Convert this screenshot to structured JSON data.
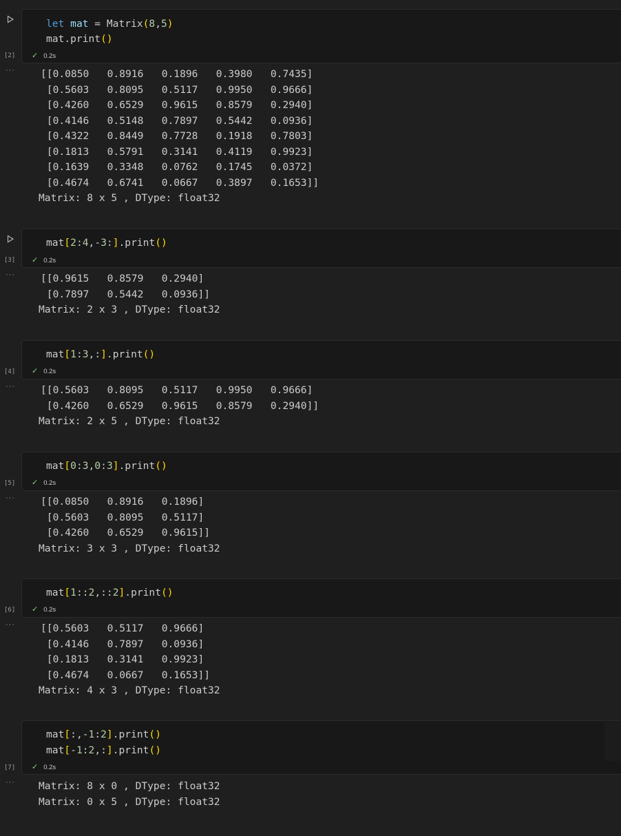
{
  "cells": [
    {
      "exec_count": "[2]",
      "status": "0.2s",
      "code_lines": [
        [
          [
            "kw",
            "let"
          ],
          [
            "txt",
            " "
          ],
          [
            "var",
            "mat"
          ],
          [
            "txt",
            " = Matrix"
          ],
          [
            "br",
            "("
          ],
          [
            "num",
            "8"
          ],
          [
            "txt",
            ","
          ],
          [
            "num",
            "5"
          ],
          [
            "br",
            ")"
          ]
        ],
        [
          [
            "txt",
            "mat.print"
          ],
          [
            "br",
            "()"
          ]
        ]
      ],
      "output_lines": [
        "[[0.0850   0.8916   0.1896   0.3980   0.7435]",
        " [0.5603   0.8095   0.5117   0.9950   0.9666]",
        " [0.4260   0.6529   0.9615   0.8579   0.2940]",
        " [0.4146   0.5148   0.7897   0.5442   0.0936]",
        " [0.4322   0.8449   0.7728   0.1918   0.7803]",
        " [0.1813   0.5791   0.3141   0.4119   0.9923]",
        " [0.1639   0.3348   0.0762   0.1745   0.0372]",
        " [0.4674   0.6741   0.0667   0.3897   0.1653]]",
        "Matrix: 8 x 5 , DType: float32"
      ]
    },
    {
      "exec_count": "[3]",
      "status": "0.2s",
      "code_lines": [
        [
          [
            "txt",
            "mat"
          ],
          [
            "br",
            "["
          ],
          [
            "num",
            "2"
          ],
          [
            "txt",
            ":"
          ],
          [
            "num",
            "4"
          ],
          [
            "txt",
            ",-"
          ],
          [
            "num",
            "3"
          ],
          [
            "txt",
            ":"
          ],
          [
            "br",
            "]"
          ],
          [
            "txt",
            ".print"
          ],
          [
            "br",
            "()"
          ]
        ]
      ],
      "output_lines": [
        "[[0.9615   0.8579   0.2940]",
        " [0.7897   0.5442   0.0936]]",
        "Matrix: 2 x 3 , DType: float32"
      ]
    },
    {
      "exec_count": "[4]",
      "status": "0.2s",
      "code_lines": [
        [
          [
            "txt",
            "mat"
          ],
          [
            "br",
            "["
          ],
          [
            "num",
            "1"
          ],
          [
            "txt",
            ":"
          ],
          [
            "num",
            "3"
          ],
          [
            "txt",
            ",:"
          ],
          [
            "br",
            "]"
          ],
          [
            "txt",
            ".print"
          ],
          [
            "br",
            "()"
          ]
        ]
      ],
      "output_lines": [
        "[[0.5603   0.8095   0.5117   0.9950   0.9666]",
        " [0.4260   0.6529   0.9615   0.8579   0.2940]]",
        "Matrix: 2 x 5 , DType: float32"
      ]
    },
    {
      "exec_count": "[5]",
      "status": "0.2s",
      "code_lines": [
        [
          [
            "txt",
            "mat"
          ],
          [
            "br",
            "["
          ],
          [
            "num",
            "0"
          ],
          [
            "txt",
            ":"
          ],
          [
            "num",
            "3"
          ],
          [
            "txt",
            ","
          ],
          [
            "num",
            "0"
          ],
          [
            "txt",
            ":"
          ],
          [
            "num",
            "3"
          ],
          [
            "br",
            "]"
          ],
          [
            "txt",
            ".print"
          ],
          [
            "br",
            "()"
          ]
        ]
      ],
      "output_lines": [
        "[[0.0850   0.8916   0.1896]",
        " [0.5603   0.8095   0.5117]",
        " [0.4260   0.6529   0.9615]]",
        "Matrix: 3 x 3 , DType: float32"
      ]
    },
    {
      "exec_count": "[6]",
      "status": "0.2s",
      "code_lines": [
        [
          [
            "txt",
            "mat"
          ],
          [
            "br",
            "["
          ],
          [
            "num",
            "1"
          ],
          [
            "txt",
            "::"
          ],
          [
            "num",
            "2"
          ],
          [
            "txt",
            ",::"
          ],
          [
            "num",
            "2"
          ],
          [
            "br",
            "]"
          ],
          [
            "txt",
            ".print"
          ],
          [
            "br",
            "()"
          ]
        ]
      ],
      "output_lines": [
        "[[0.5603   0.5117   0.9666]",
        " [0.4146   0.7897   0.0936]",
        " [0.1813   0.3141   0.9923]",
        " [0.4674   0.0667   0.1653]]",
        "Matrix: 4 x 3 , DType: float32"
      ]
    },
    {
      "exec_count": "[7]",
      "status": "0.2s",
      "code_lines": [
        [
          [
            "txt",
            "mat"
          ],
          [
            "br",
            "["
          ],
          [
            "txt",
            ":,-"
          ],
          [
            "num",
            "1"
          ],
          [
            "txt",
            ":"
          ],
          [
            "num",
            "2"
          ],
          [
            "br",
            "]"
          ],
          [
            "txt",
            ".print"
          ],
          [
            "br",
            "()"
          ]
        ],
        [
          [
            "txt",
            "mat"
          ],
          [
            "br",
            "["
          ],
          [
            "txt",
            "-"
          ],
          [
            "num",
            "1"
          ],
          [
            "txt",
            ":"
          ],
          [
            "num",
            "2"
          ],
          [
            "txt",
            ",:"
          ],
          [
            "br",
            "]"
          ],
          [
            "txt",
            ".print"
          ],
          [
            "br",
            "()"
          ]
        ]
      ],
      "output_lines": [
        "Matrix: 8 x 0 , DType: float32",
        "Matrix: 0 x 5 , DType: float32"
      ]
    }
  ],
  "icons": {
    "run": "run-triangle-icon",
    "check": "check-icon",
    "more": "more-ellipsis-icon"
  },
  "colors": {
    "background": "#1f1f1f",
    "cell_bg": "#181818",
    "keyword": "#569cd6",
    "variable": "#9cdcfe",
    "number": "#b5cea8",
    "bracket": "#ffd700",
    "check": "#89d185"
  }
}
